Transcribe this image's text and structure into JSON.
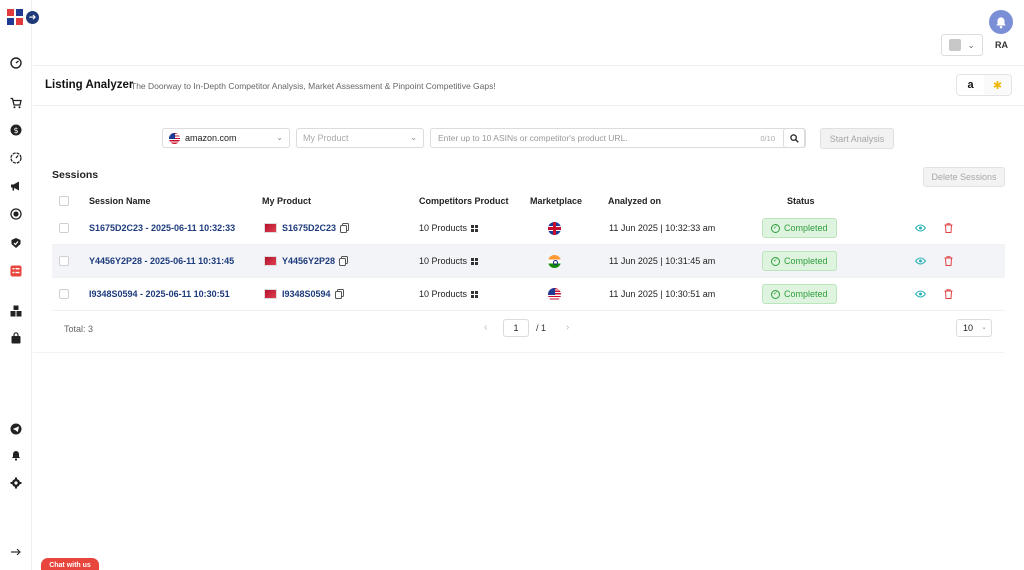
{
  "header": {
    "user_initials": "RA"
  },
  "page": {
    "title": "Listing Analyzer",
    "subtitle": "The Doorway to In-Depth Competitor Analysis, Market Assessment & Pinpoint Competitive Gaps!"
  },
  "marketplace_toggle": {
    "amazon_glyph": "a",
    "walmart_glyph": "✱"
  },
  "search": {
    "marketplace_value": "amazon.com",
    "product_placeholder": "My Product",
    "asin_placeholder": "Enter up to 10 ASINs or competitor's product URL.",
    "asin_count": "0/10",
    "start_label": "Start Analysis"
  },
  "sessions": {
    "title": "Sessions",
    "delete_label": "Delete Sessions",
    "columns": [
      "Session Name",
      "My Product",
      "Competitors Product",
      "Marketplace",
      "Analyzed on",
      "Status"
    ],
    "rows": [
      {
        "name": "S1675D2C23 - 2025-06-11 10:32:33",
        "asin": "S1675D2C23",
        "competitors": "10 Products",
        "marketplace": "gb",
        "analyzed": "11 Jun 2025 | 10:32:33 am",
        "status": "Completed"
      },
      {
        "name": "Y4456Y2P28 - 2025-06-11 10:31:45",
        "asin": "Y4456Y2P28",
        "competitors": "10 Products",
        "marketplace": "in",
        "analyzed": "11 Jun 2025 | 10:31:45 am",
        "status": "Completed"
      },
      {
        "name": "I9348S0594 - 2025-06-11 10:30:51",
        "asin": "I9348S0594",
        "competitors": "10 Products",
        "marketplace": "us",
        "analyzed": "11 Jun 2025 | 10:30:51 am",
        "status": "Completed"
      }
    ]
  },
  "pagination": {
    "total": "Total: 3",
    "current_page": "1",
    "of_pages": "/ 1",
    "page_size": "10"
  },
  "chat": {
    "label": "Chat with us"
  },
  "colors": {
    "accent_navy": "#1d3b7c",
    "status_green": "#2e9e3e",
    "chat_red": "#e8453c",
    "bell_bg": "#7b8fd6"
  }
}
